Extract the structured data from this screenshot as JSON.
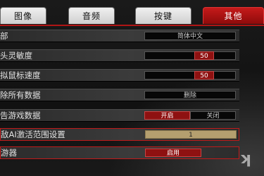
{
  "tabs": [
    {
      "label": "图像"
    },
    {
      "label": "音频"
    },
    {
      "label": "按键"
    },
    {
      "label": "其他"
    }
  ],
  "active_tab": "其他",
  "settings": {
    "language": {
      "label": "部",
      "value": "简体中文"
    },
    "sensitivity": {
      "label": "头灵敏度",
      "value": "50"
    },
    "mouse_speed": {
      "label": "拟鼠标速度",
      "value": "50"
    },
    "delete_data": {
      "label": "除所有数据",
      "button": "删除"
    },
    "game_data": {
      "label": "告游戏数据",
      "option_on": "开启",
      "option_off": "关闭",
      "selected": "开启"
    },
    "ai_range": {
      "label": "敌AI激活范围设置",
      "value": "1"
    },
    "equipment": {
      "label": "游器",
      "button": "启用"
    }
  }
}
